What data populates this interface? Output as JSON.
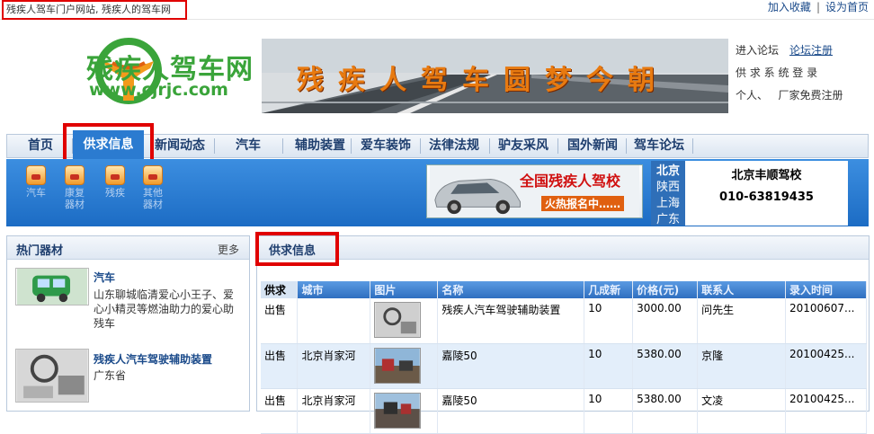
{
  "top": {
    "site_title": "残疾人驾车门户网站, 残疾人的驾车网",
    "add_favorite": "加入收藏",
    "set_homepage": "设为首页"
  },
  "logo": {
    "name": "残疾人驾车网",
    "url": "www.cjrjc.com"
  },
  "banner": {
    "text": "残疾人驾车圆梦今朝"
  },
  "login": {
    "forum_enter": "进入论坛",
    "forum_register": "论坛注册",
    "supply_login": "供 求 系 统 登 录",
    "personal": "个人、",
    "vendor_register": "厂家免费注册"
  },
  "nav": {
    "items": [
      "首页",
      "供求信息",
      "新闻动态",
      "汽车",
      "辅助装置",
      "爱车装饰",
      "法律法规",
      "驴友采风",
      "国外新闻",
      "驾车论坛"
    ]
  },
  "categories": [
    "汽车",
    "康复器材",
    "残疾",
    "其他器材"
  ],
  "ad": {
    "title": "全国残疾人驾校",
    "subtitle": "火热报名中……",
    "cities": [
      "北京",
      "陕西",
      "上海",
      "广东"
    ],
    "school_name": "北京丰顺驾校",
    "phone": "010-63819435"
  },
  "sidebar": {
    "title": "热门器材",
    "more": "更多",
    "products": [
      {
        "title": "汽车",
        "desc": "山东聊城临清爱心小王子、爱心小精灵等燃油助力的爱心助残车"
      },
      {
        "title": "残疾人汽车驾驶辅助装置",
        "desc": "广东省"
      }
    ]
  },
  "main": {
    "title": "供求信息",
    "columns": [
      "供求",
      "城市",
      "图片",
      "名称",
      "几成新",
      "价格(元)",
      "联系人",
      "录入时间"
    ],
    "rows": [
      {
        "type": "出售",
        "city": "",
        "name": "残疾人汽车驾驶辅助装置",
        "condition": "10",
        "price": "3000.00",
        "contact": "问先生",
        "date": "20100607..."
      },
      {
        "type": "出售",
        "city": "北京肖家河",
        "name": "嘉陵50",
        "condition": "10",
        "price": "5380.00",
        "contact": "京隆",
        "date": "20100425..."
      },
      {
        "type": "出售",
        "city": "北京肖家河",
        "name": "嘉陵50",
        "condition": "10",
        "price": "5380.00",
        "contact": "文凌",
        "date": "20100425..."
      }
    ]
  },
  "colors": {
    "accent": "#2b7bd0",
    "highlight": "#e00000",
    "logo_green": "#3aa43a",
    "banner_orange": "#e87a10"
  }
}
